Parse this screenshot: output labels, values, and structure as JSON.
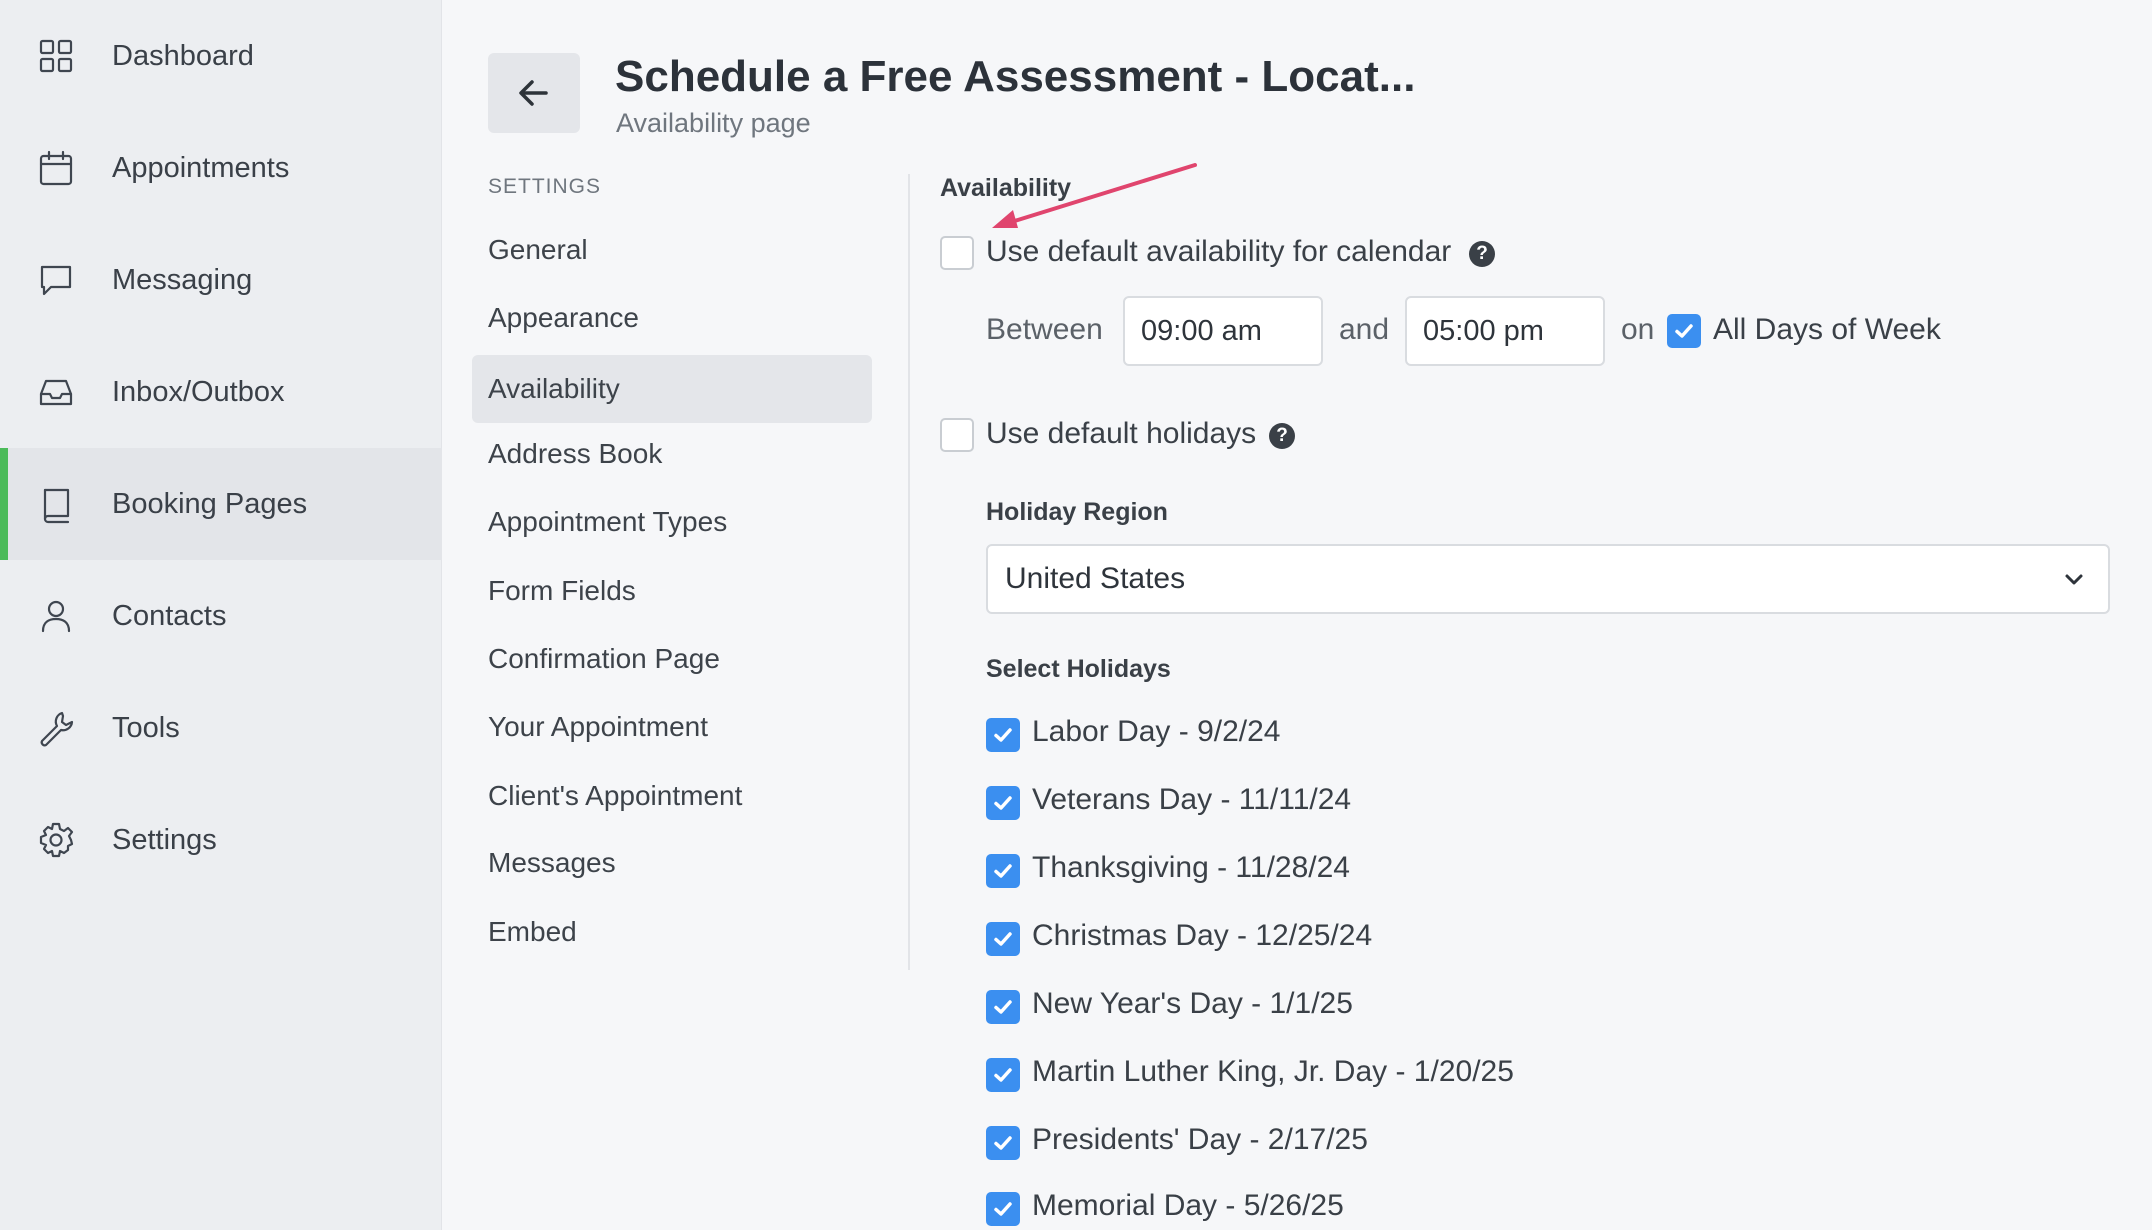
{
  "sidebar": {
    "items": [
      {
        "label": "Dashboard"
      },
      {
        "label": "Appointments"
      },
      {
        "label": "Messaging"
      },
      {
        "label": "Inbox/Outbox"
      },
      {
        "label": "Booking Pages"
      },
      {
        "label": "Contacts"
      },
      {
        "label": "Tools"
      },
      {
        "label": "Settings"
      }
    ],
    "active": "Booking Pages"
  },
  "header": {
    "title": "Schedule a Free Assessment - Locat...",
    "subtitle": "Availability page"
  },
  "settings_nav": {
    "heading": "SETTINGS",
    "items": [
      {
        "label": "General"
      },
      {
        "label": "Appearance"
      },
      {
        "label": "Availability"
      },
      {
        "label": "Address Book"
      },
      {
        "label": "Appointment Types"
      },
      {
        "label": "Form Fields"
      },
      {
        "label": "Confirmation Page"
      },
      {
        "label": "Your Appointment"
      },
      {
        "label": "Client's Appointment"
      },
      {
        "label": "Messages"
      },
      {
        "label": "Embed"
      }
    ],
    "active": "Availability"
  },
  "availability": {
    "section_title": "Availability",
    "default_availability_label": "Use default availability for calendar",
    "default_availability_checked": false,
    "between_label": "Between",
    "start_time": "09:00 am",
    "and_label": "and",
    "end_time": "05:00 pm",
    "on_label": "on",
    "all_days_label": "All Days of Week",
    "all_days_checked": true,
    "default_holidays_label": "Use default holidays",
    "default_holidays_checked": false,
    "holiday_region_label": "Holiday Region",
    "holiday_region_value": "United States",
    "select_holidays_label": "Select Holidays",
    "holidays": [
      {
        "label": "Labor Day - 9/2/24",
        "checked": true
      },
      {
        "label": "Veterans Day - 11/11/24",
        "checked": true
      },
      {
        "label": "Thanksgiving - 11/28/24",
        "checked": true
      },
      {
        "label": "Christmas Day - 12/25/24",
        "checked": true
      },
      {
        "label": "New Year's Day - 1/1/25",
        "checked": true
      },
      {
        "label": "Martin Luther King, Jr. Day - 1/20/25",
        "checked": true
      },
      {
        "label": "Presidents' Day - 2/17/25",
        "checked": true
      },
      {
        "label": "Memorial Day - 5/26/25",
        "checked": true
      }
    ]
  },
  "colors": {
    "accent": "#3b8ff0",
    "active_indicator": "#4cbb5a",
    "annotation_arrow": "#e0456e"
  }
}
